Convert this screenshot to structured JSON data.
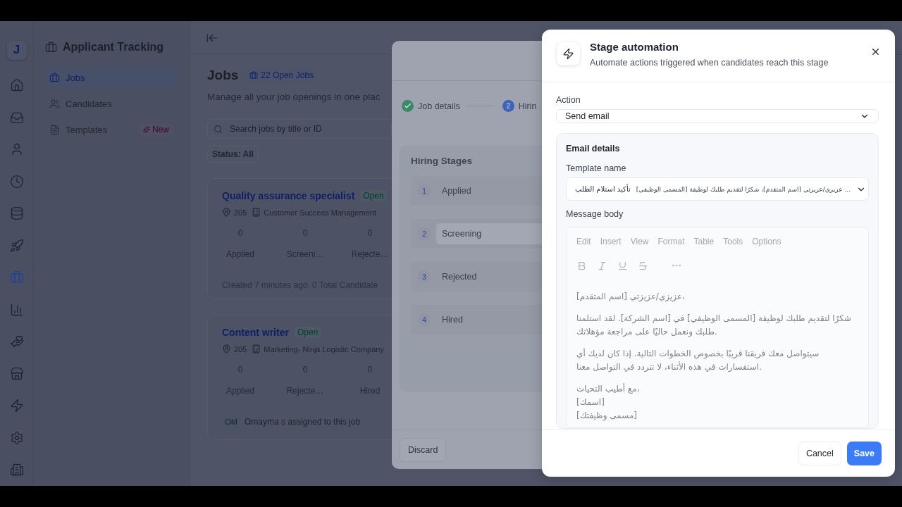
{
  "rail": {
    "logo": "J",
    "items": [
      {
        "selected": false
      },
      {
        "selected": false
      },
      {
        "selected": false
      },
      {
        "selected": false
      },
      {
        "selected": false
      },
      {
        "selected": false
      },
      {
        "selected": true
      },
      {
        "selected": false
      },
      {
        "selected": false
      },
      {
        "selected": false
      },
      {
        "selected": false
      },
      {
        "selected": false
      },
      {
        "selected": false
      }
    ]
  },
  "sidebar": {
    "title": "Applicant Tracking",
    "items": [
      {
        "label": "Jobs",
        "selected": true
      },
      {
        "label": "Candidates",
        "selected": false
      },
      {
        "label": "Templates",
        "selected": false,
        "badge": "New"
      }
    ]
  },
  "page": {
    "title": "Jobs",
    "badge": "22 Open Jobs",
    "subtitle": "Manage all your job openings in one plac",
    "search": {
      "placeholder": "Search jobs by title or ID"
    },
    "status_filter": "Status: All",
    "jobs": [
      {
        "title": "Quality assurance specialist",
        "status": "Open",
        "location": "205",
        "department": "Customer Success Management",
        "stats": [
          {
            "count": "0",
            "label": "Applied"
          },
          {
            "count": "0",
            "label": "Screeni…"
          },
          {
            "count": "0",
            "label": "Rejecte…"
          }
        ],
        "footer": "Created 7 minutes ago. 0 Total Candidate"
      },
      {
        "title": "Content writer",
        "status": "Open",
        "location": "205",
        "department": "Marketing- Ninja Logistic Company",
        "stats": [
          {
            "count": "0",
            "label": "Applied"
          },
          {
            "count": "0",
            "label": "Rejecte…"
          },
          {
            "count": "0",
            "label": "Hired"
          }
        ],
        "assignee": {
          "initials": "OM",
          "text": "Omayma s assigned to this job"
        }
      }
    ]
  },
  "job_modal": {
    "steps": [
      {
        "label": "Job details",
        "done": true
      },
      {
        "number": "2",
        "label": "Hirin",
        "done": false
      }
    ],
    "stages_title": "Hiring Stages",
    "stages": [
      {
        "number": "1",
        "name": "Applied",
        "editing": false
      },
      {
        "number": "2",
        "name": "Screening",
        "editing": true
      },
      {
        "number": "3",
        "name": "Rejected",
        "editing": false
      },
      {
        "number": "4",
        "name": "Hired",
        "editing": false
      }
    ],
    "discard": "Discard"
  },
  "drawer": {
    "title": "Stage automation",
    "subtitle": "Automate actions triggered when candidates reach this stage",
    "action": {
      "label": "Action",
      "value": "Send email"
    },
    "email": {
      "title": "Email details",
      "template": {
        "label": "Template name",
        "name": "تأكيد استلام الطلب",
        "preview": "عزيزي/عزيزتي [اسم المتقدم]، شكرًا لتقديم طلبك لوظيفة [المسمى الوظيفي] ..."
      },
      "body": {
        "label": "Message body",
        "menu": [
          "Edit",
          "Insert",
          "View",
          "Format",
          "Table",
          "Tools",
          "Options"
        ],
        "paragraphs": [
          [
            "عزيزي/عزيزتي [اسم المتقدم]،"
          ],
          [
            "شكرًا لتقديم طلبك لوظيفة [المسمى الوظيفي] في [اسم الشركة]. لقد استلمنا طلبك ونعمل حاليًا على مراجعة مؤهلاتك."
          ],
          [
            "سيتواصل معك فريقنا قريبًا بخصوص الخطوات التالية. إذا كان لديك أي استفسارات في هذه الأثناء، لا تتردد في التواصل معنا."
          ],
          [
            "مع أطيب التحيات،",
            "[اسمك]",
            "[مسمى وظيفتك]"
          ]
        ]
      }
    },
    "buttons": {
      "cancel": "Cancel",
      "save": "Save"
    }
  }
}
